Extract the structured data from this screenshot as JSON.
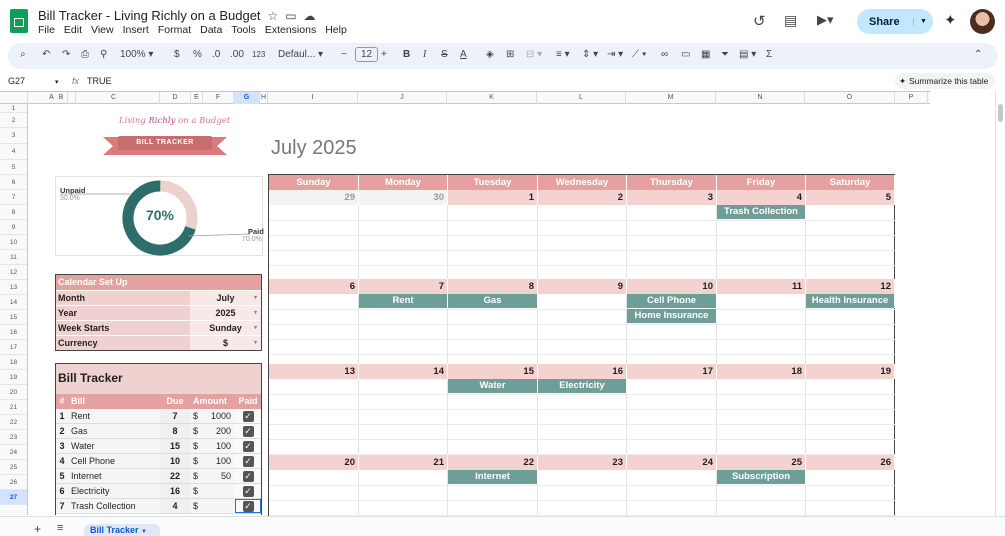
{
  "app": {
    "title": "Bill Tracker - Living Richly on a Budget",
    "menu": [
      "File",
      "Edit",
      "View",
      "Insert",
      "Format",
      "Data",
      "Tools",
      "Extensions",
      "Help"
    ],
    "share_label": "Share"
  },
  "toolbar": {
    "zoom": "100%",
    "currency": "$",
    "percent": "%",
    "dec_less": ".0",
    "dec_more": ".00",
    "number_format": "123",
    "font": "Defaul...",
    "font_size": "12"
  },
  "formula_bar": {
    "cell_ref": "G27",
    "fx": "fx",
    "value": "TRUE",
    "summarize_label": "Summarize this table"
  },
  "columns": [
    "A",
    "B",
    "C",
    "D",
    "E",
    "F",
    "G",
    "H",
    "I",
    "J",
    "K",
    "L",
    "M",
    "N",
    "O",
    "P"
  ],
  "selected_column": "G",
  "rows": [
    "1",
    "2",
    "3",
    "4",
    "5",
    "6",
    "7",
    "8",
    "9",
    "10",
    "11",
    "12",
    "13",
    "14",
    "15",
    "16",
    "17",
    "18",
    "19",
    "20",
    "21",
    "22",
    "23",
    "24",
    "25",
    "26",
    "27"
  ],
  "selected_row": "27",
  "branding": {
    "logo_text_a": "Living ",
    "logo_text_b": "Richly",
    "logo_text_c": " on a Budget",
    "banner": "BILL TRACKER"
  },
  "calendar_title": "July 2025",
  "donut": {
    "unpaid_label": "Unpaid",
    "unpaid_pct": "30.0%",
    "paid_label": "Paid",
    "paid_pct": "70.0%",
    "center": "70%",
    "paid_fraction": 0.7,
    "paid_color": "#2e6e6a",
    "unpaid_color": "#ecd2cc"
  },
  "setup": {
    "title": "Calendar Set Up",
    "rows": [
      {
        "label": "Month",
        "value": "July"
      },
      {
        "label": "Year",
        "value": "2025"
      },
      {
        "label": "Week Starts",
        "value": "Sunday"
      },
      {
        "label": "Currency",
        "value": "$"
      }
    ]
  },
  "bills": {
    "title": "Bill Tracker",
    "headers": {
      "num": "#",
      "bill": "Bill",
      "due": "Due",
      "amount": "Amount",
      "paid": "Paid"
    },
    "rows": [
      {
        "num": "1",
        "bill": "Rent",
        "due": "7",
        "cur": "$",
        "amount": "1000",
        "paid": "✓"
      },
      {
        "num": "2",
        "bill": "Gas",
        "due": "8",
        "cur": "$",
        "amount": "200",
        "paid": "✓"
      },
      {
        "num": "3",
        "bill": "Water",
        "due": "15",
        "cur": "$",
        "amount": "100",
        "paid": "✓"
      },
      {
        "num": "4",
        "bill": "Cell Phone",
        "due": "10",
        "cur": "$",
        "amount": "100",
        "paid": "✓"
      },
      {
        "num": "5",
        "bill": "Internet",
        "due": "22",
        "cur": "$",
        "amount": "50",
        "paid": "✓"
      },
      {
        "num": "6",
        "bill": "Electricity",
        "due": "16",
        "cur": "$",
        "amount": "",
        "paid": "✓"
      },
      {
        "num": "7",
        "bill": "Trash Collection",
        "due": "4",
        "cur": "$",
        "amount": "",
        "paid": "✓"
      }
    ]
  },
  "calendar": {
    "days": [
      "Sunday",
      "Monday",
      "Tuesday",
      "Wednesday",
      "Thursday",
      "Friday",
      "Saturday"
    ],
    "weeks": [
      [
        "29",
        "30",
        "1",
        "2",
        "3",
        "4",
        "5"
      ],
      [
        "6",
        "7",
        "8",
        "9",
        "10",
        "11",
        "12"
      ],
      [
        "13",
        "14",
        "15",
        "16",
        "17",
        "18",
        "19"
      ],
      [
        "20",
        "21",
        "22",
        "23",
        "24",
        "25",
        "26"
      ]
    ],
    "muted": [
      [
        0,
        0
      ],
      [
        0,
        1
      ]
    ],
    "events": [
      {
        "week": 0,
        "day": 5,
        "slot": 0,
        "label": "Trash Collection"
      },
      {
        "week": 1,
        "day": 1,
        "slot": 0,
        "label": "Rent"
      },
      {
        "week": 1,
        "day": 2,
        "slot": 0,
        "label": "Gas"
      },
      {
        "week": 1,
        "day": 4,
        "slot": 0,
        "label": "Cell Phone"
      },
      {
        "week": 1,
        "day": 4,
        "slot": 1,
        "label": "Home Insurance"
      },
      {
        "week": 1,
        "day": 6,
        "slot": 0,
        "label": "Health Insurance"
      },
      {
        "week": 2,
        "day": 2,
        "slot": 0,
        "label": "Water"
      },
      {
        "week": 2,
        "day": 3,
        "slot": 0,
        "label": "Electricity"
      },
      {
        "week": 3,
        "day": 2,
        "slot": 0,
        "label": "Internet"
      },
      {
        "week": 3,
        "day": 5,
        "slot": 0,
        "label": "Subscription"
      }
    ]
  },
  "sheet_tab": "Bill Tracker"
}
